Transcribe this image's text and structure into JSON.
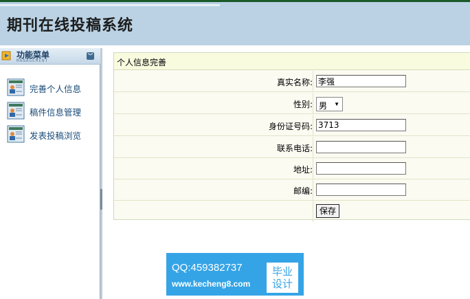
{
  "header": {
    "title": "期刊在线投稿系统"
  },
  "menu": {
    "title": "功能菜单",
    "subtitle": "MANAGEMENT",
    "items": [
      {
        "label": "完善个人信息",
        "icon": "user-document-icon"
      },
      {
        "label": "稿件信息管理",
        "icon": "user-document-icon"
      },
      {
        "label": "发表投稿浏览",
        "icon": "user-document-icon"
      }
    ]
  },
  "form": {
    "title": "个人信息完善",
    "fields": {
      "real_name": {
        "label": "真实名称:",
        "value": "李强"
      },
      "gender": {
        "label": "性别:",
        "value": "男"
      },
      "id_number": {
        "label": "身份证号码:",
        "value": "3713"
      },
      "phone": {
        "label": "联系电话:",
        "value": ""
      },
      "address": {
        "label": "地址:",
        "value": ""
      },
      "postcode": {
        "label": "邮编:",
        "value": ""
      }
    },
    "save_label": "保存"
  },
  "watermark": {
    "qq": "QQ:459382737",
    "site": "www.kecheng8.com",
    "badge_line1": "毕业",
    "badge_line2": "设计"
  }
}
